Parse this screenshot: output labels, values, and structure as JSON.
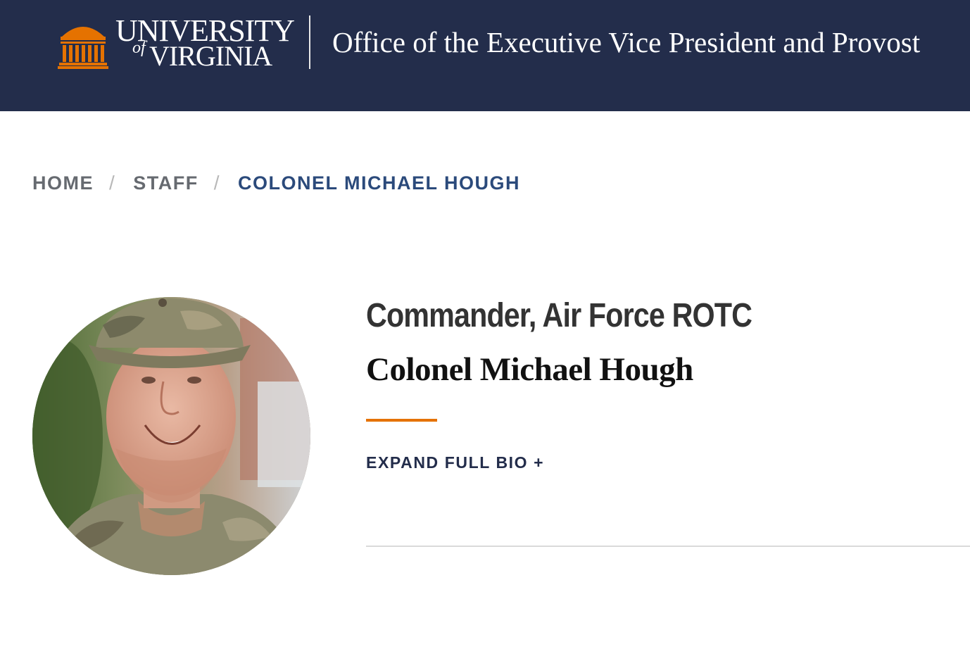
{
  "header": {
    "logo": {
      "alt": "University of Virginia",
      "word_top": "UNIVERSITY",
      "word_of": "of",
      "word_bottom": "VIRGINIA",
      "icon": "rotunda-icon"
    },
    "office_title": "Office of the Executive Vice President and Provost"
  },
  "breadcrumb": {
    "items": [
      {
        "label": "HOME"
      },
      {
        "label": "STAFF"
      },
      {
        "label": "COLONEL MICHAEL HOUGH"
      }
    ],
    "separator": "/"
  },
  "profile": {
    "title": "Commander, Air Force ROTC",
    "name": "Colonel Michael Hough",
    "photo_alt": "Colonel Michael Hough",
    "expand_label": "EXPAND FULL BIO +"
  },
  "colors": {
    "header_bg": "#232D4B",
    "accent": "#E57200",
    "link": "#232D4B",
    "breadcrumb_current": "#2B4A7B"
  }
}
